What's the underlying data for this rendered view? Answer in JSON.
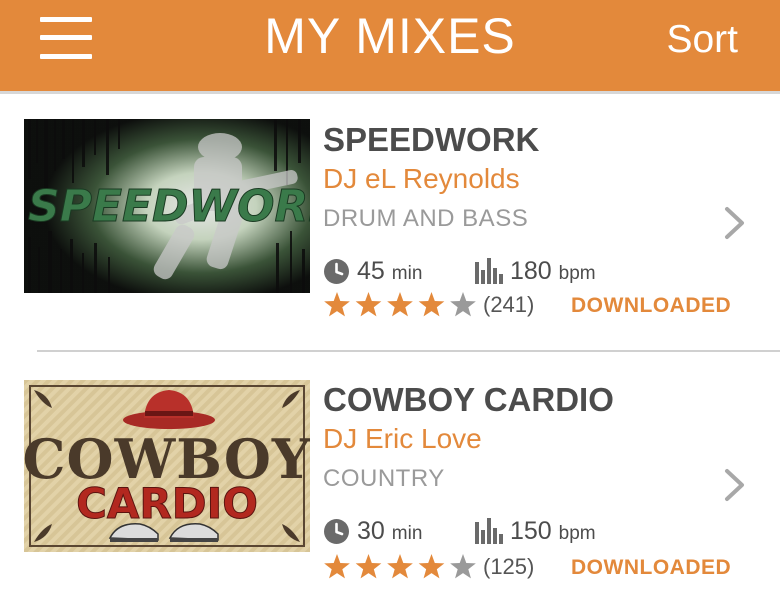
{
  "header": {
    "title": "MY MIXES",
    "sort_label": "Sort",
    "menu_icon": "hamburger-menu-icon",
    "background": "#e3893b"
  },
  "accent_color": "#e3893b",
  "mixes": [
    {
      "cover_text": "SPEEDWORK",
      "title": "SPEEDWORK",
      "dj": "DJ eL Reynolds",
      "genre": "DRUM AND BASS",
      "duration": "45",
      "duration_unit": "min",
      "bpm": "180",
      "bpm_unit": "bpm",
      "rating": 4,
      "rating_max": 5,
      "rating_count": "(241)",
      "status": "DOWNLOADED"
    },
    {
      "cover_text_top": "COWBOY",
      "cover_text_bottom": "CARDIO",
      "title": "COWBOY CARDIO",
      "dj": "DJ Eric Love",
      "genre": "COUNTRY",
      "duration": "30",
      "duration_unit": "min",
      "bpm": "150",
      "bpm_unit": "bpm",
      "rating": 4,
      "rating_max": 5,
      "rating_count": "(125)",
      "status": "DOWNLOADED"
    }
  ]
}
